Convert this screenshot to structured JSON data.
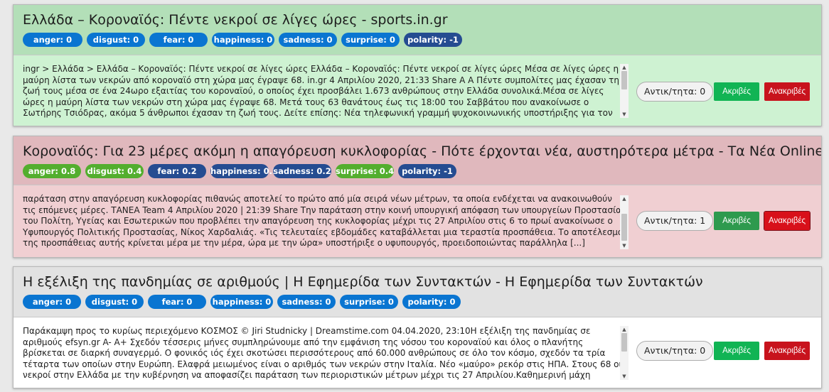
{
  "colors": {
    "badge_blue": "#0a75d1",
    "badge_blue_dark": "#254c91",
    "badge_green": "#53ae2e",
    "card1_head_bg": "#b3dfb8",
    "card1_body_bg": "#cef2d2",
    "card2_head_bg": "#e0b8bd",
    "card2_body_bg": "#f0cfd2",
    "card3_head_bg": "#e2e2e2",
    "card3_body_bg": "#ffffff",
    "accurate_btn": "#11b454",
    "inaccurate_btn": "#c8131d"
  },
  "articles": [
    {
      "title": "Ελλάδα – Κοροναϊός: Πέντε νεκροί σε λίγες ώρες - sports.in.gr",
      "badges": [
        {
          "label": "anger: 0",
          "variant": "blue"
        },
        {
          "label": "disgust: 0",
          "variant": "blue"
        },
        {
          "label": "fear: 0",
          "variant": "blue"
        },
        {
          "label": "happiness: 0",
          "variant": "blue"
        },
        {
          "label": "sadness: 0",
          "variant": "blue"
        },
        {
          "label": "surprise: 0",
          "variant": "blue"
        },
        {
          "label": "polarity: -1",
          "variant": "dark"
        }
      ],
      "text": "ingr > Ελλάδα > Ελλάδα – Κοροναϊός: Πέντε νεκροί σε λίγες ώρες Ελλάδα – Κοροναϊός: Πέντε νεκροί σε λίγες ώρες Μέσα σε λίγες ώρες η μαύρη λίστα των νεκρών από κοροναϊό στη χώρα μας έγραψε 68. in.gr 4 Απριλίου 2020, 21:33 Share A A Πέντε συμπολίτες μας έχασαν τη ζωή τους μέσα σε ένα 24ωρο εξαιτίας του κοροναϊού, ο οποίος έχει προσβάλει 1.673 ανθρώπους στην Ελλάδα συνολικά.Μέσα σε λίγες ώρες η μαύρη λίστα των νεκρών στη χώρα μας έγραψε 68. Μετά τους 63 θανάτους έως τις 18:00 του Σαββάτου που ανακοίνωσε ο Σωτήρης Τσιόδρας, ακόμα 5 άνθρωποι έχασαν τη ζωή τους. Δείτε επίσης: Νέα τηλεφωνική γραμμή ψυχοκοινωνικής υποστήριξης για τον κοροναϊό Όπως ανέφερε ο",
      "counter": "Αντικ/τητα: 0",
      "accurate_label": "Ακριβές",
      "inaccurate_label": "Ανακριβές"
    },
    {
      "title": "Κοροναϊός: Για 23 μέρες ακόμη η απαγόρευση κυκλοφορίας - Πότε έρχονται νέα, αυστηρότερα μέτρα - Τα Νέα Online",
      "badges": [
        {
          "label": "anger: 0.8",
          "variant": "green"
        },
        {
          "label": "disgust: 0.4",
          "variant": "green"
        },
        {
          "label": "fear: 0.2",
          "variant": "dark"
        },
        {
          "label": "happiness: 0.2",
          "variant": "dark"
        },
        {
          "label": "sadness: 0.2",
          "variant": "dark"
        },
        {
          "label": "surprise: 0.4",
          "variant": "green"
        },
        {
          "label": "polarity: -1",
          "variant": "dark"
        }
      ],
      "text": "παράταση στην απαγόρευση κυκλοφορίας πιθανώς αποτελεί το πρώτο από μία σειρά νέων μέτρων, τα οποία ενδέχεται να ανακοινωθούν τις επόμενες μέρες. ΤΑΝΕΑ Team 4 Απριλίου 2020 | 21:39 Share Την παράταση στην κοινή υπουργική απόφαση των υπουργείων Προστασίας του Πολίτη, Υγείας και Εσωτερικών που προβλέπει την απαγόρευση της κυκλοφορίας μέχρι τις 27 Απριλίου στις 6 το πρωί ανακοίνωσε ο Υφυπουργός Πολιτικής Προστασίας, Νίκος Χαρδαλιάς. «Τις τελευταίες εβδομάδες καταβάλλεται μια τεραστία προσπάθεια. Το αποτέλεσμα της προσπάθειας αυτής κρίνεται μέρα με την μέρα, ώρα με την ώρα» υποστήριξε ο υφυπουργός, προειδοποιώντας παράλληλα [...]",
      "counter": "Αντικ/τητα: 1",
      "accurate_label": "Ακριβές",
      "inaccurate_label": "Ανακριβές"
    },
    {
      "title": "Η εξέλιξη της πανδημίας σε αριθμούς | Η Εφημερίδα των Συντακτών - Η Εφημερίδα των Συντακτών",
      "badges": [
        {
          "label": "anger: 0",
          "variant": "blue"
        },
        {
          "label": "disgust: 0",
          "variant": "blue"
        },
        {
          "label": "fear: 0",
          "variant": "blue"
        },
        {
          "label": "happiness: 0",
          "variant": "blue"
        },
        {
          "label": "sadness: 0",
          "variant": "blue"
        },
        {
          "label": "surprise: 0",
          "variant": "blue"
        },
        {
          "label": "polarity: 0",
          "variant": "blue"
        }
      ],
      "text": "Παράκαμψη προς το κυρίως περιεχόμενο ΚΟΣΜΟΣ © Jiri Studnicky | Dreamstime.com 04.04.2020, 23:10Η εξέλιξη της πανδημίας σε αριθμούς efsyn.gr A- A+ Σχεδόν τέσσερις μήνες συμπληρώνουμε από την εμφάνιση της νόσου του κοροναϊού και όλος ο πλανήτης βρίσκεται σε διαρκή συναγερμό. Ο φονικός ιός έχει σκοτώσει περισσότερους από 60.000 ανθρώπους σε όλο τον κόσμο, σχεδόν τα τρία τέταρτα των οποίων στην Ευρώπη. Ελαφρά μειωμένος είναι ο αριθμός των νεκρών στην Ιταλία. Νέο «μαύρο» ρεκόρ στις ΗΠΑ. Στους 68 οι νεκροί στην Ελλάδα με την κυβέρνηση να αποφασίζει παράταση των περιοριστικών μέτρων μέχρι τις 27 Απριλίου.Καθημερινή μάχη απέναντι στον «αόρατο» εχθρό",
      "counter": "Αντικ/τητα: 0",
      "accurate_label": "Ακριβές",
      "inaccurate_label": "Ανακριβές"
    }
  ]
}
